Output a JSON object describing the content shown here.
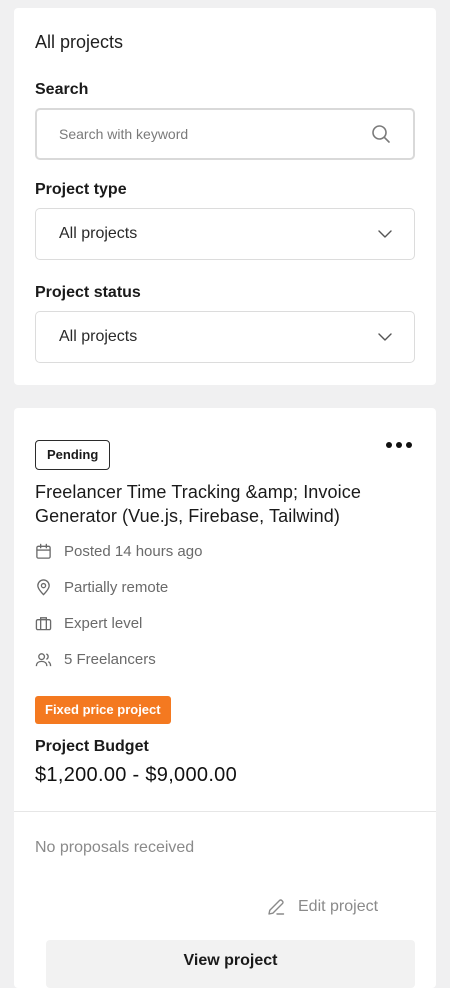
{
  "filters": {
    "title": "All projects",
    "search_label": "Search",
    "search_placeholder": "Search with keyword",
    "type_label": "Project type",
    "type_value": "All projects",
    "status_label": "Project status",
    "status_value": "All projects"
  },
  "project": {
    "status_badge": "Pending",
    "title": "Freelancer Time Tracking &amp; Invoice Generator (Vue.js, Firebase, Tailwind)",
    "meta": {
      "posted": "Posted 14 hours ago",
      "location": "Partially remote",
      "level": "Expert level",
      "freelancers": "5 Freelancers"
    },
    "price_type": "Fixed price project",
    "budget_label": "Project Budget",
    "budget_value": "$1,200.00 - $9,000.00",
    "proposals": "No proposals received",
    "edit_label": "Edit project",
    "view_label": "View project"
  },
  "colors": {
    "accent_orange": "#f47920",
    "page_bg": "#f0f0f1"
  },
  "icons": [
    "search-icon",
    "chevron-down-icon",
    "more-options-icon",
    "calendar-icon",
    "location-pin-icon",
    "briefcase-icon",
    "users-icon",
    "edit-pencil-icon"
  ]
}
